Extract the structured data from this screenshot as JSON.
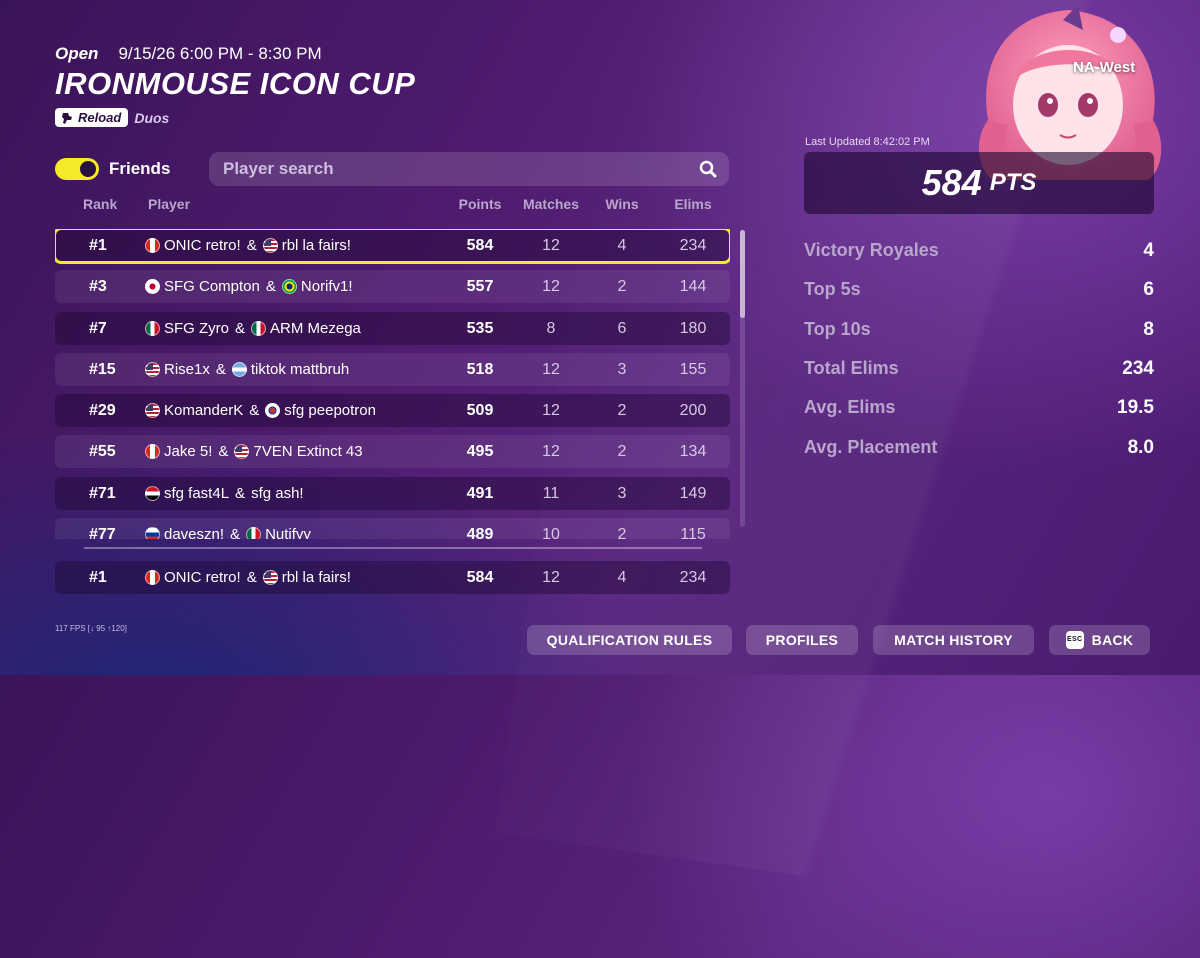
{
  "header": {
    "status": "Open",
    "datetime": "9/15/26 6:00 PM - 8:30 PM",
    "title": "IRONMOUSE ICON CUP",
    "mode_badge": "Reload",
    "team_size": "Duos"
  },
  "filters": {
    "friends_label": "Friends",
    "friends_on": true,
    "search_placeholder": "Player search"
  },
  "table": {
    "columns": [
      "Rank",
      "Player",
      "Points",
      "Matches",
      "Wins",
      "Elims"
    ],
    "rows": [
      {
        "rank": "#1",
        "p1": "ONIC retro!",
        "f1": "ca",
        "p2": "rbl la fairs!",
        "f2": "us",
        "points": "584",
        "matches": "12",
        "wins": "4",
        "elims": "234"
      },
      {
        "rank": "#3",
        "p1": "SFG Compton",
        "f1": "jp",
        "p2": "Norifv1!",
        "f2": "br",
        "points": "557",
        "matches": "12",
        "wins": "2",
        "elims": "144"
      },
      {
        "rank": "#7",
        "p1": "SFG Zyro",
        "f1": "mx",
        "p2": "ARM Mezega",
        "f2": "mx",
        "points": "535",
        "matches": "8",
        "wins": "6",
        "elims": "180"
      },
      {
        "rank": "#15",
        "p1": "Rise1x",
        "f1": "us",
        "p2": "tiktok mattbruh",
        "f2": "ar",
        "points": "518",
        "matches": "12",
        "wins": "3",
        "elims": "155"
      },
      {
        "rank": "#29",
        "p1": "KomanderK",
        "f1": "us",
        "p2": "sfg peepotron",
        "f2": "kr",
        "points": "509",
        "matches": "12",
        "wins": "2",
        "elims": "200"
      },
      {
        "rank": "#55",
        "p1": "Jake 5!",
        "f1": "ca",
        "p2": "7VEN Extinct 43",
        "f2": "us",
        "points": "495",
        "matches": "12",
        "wins": "2",
        "elims": "134"
      },
      {
        "rank": "#71",
        "p1": "sfg fast4L",
        "f1": "eg",
        "p2": "sfg ash!",
        "f2": "",
        "points": "491",
        "matches": "11",
        "wins": "3",
        "elims": "149"
      },
      {
        "rank": "#77",
        "p1": "daveszn!",
        "f1": "ru",
        "p2": "Nutifyy",
        "f2": "mx",
        "points": "489",
        "matches": "10",
        "wins": "2",
        "elims": "115"
      }
    ],
    "my_row": {
      "rank": "#1",
      "p1": "ONIC retro!",
      "f1": "ca",
      "p2": "rbl la fairs!",
      "f2": "us",
      "points": "584",
      "matches": "12",
      "wins": "4",
      "elims": "234"
    }
  },
  "panel": {
    "region": "NA-West",
    "last_updated": "Last Updated 8:42:02 PM",
    "points": "584",
    "points_unit": "PTS",
    "stats": [
      {
        "label": "Victory Royales",
        "value": "4"
      },
      {
        "label": "Top 5s",
        "value": "6"
      },
      {
        "label": "Top 10s",
        "value": "8"
      },
      {
        "label": "Total Elims",
        "value": "234"
      },
      {
        "label": "Avg. Elims",
        "value": "19.5"
      },
      {
        "label": "Avg. Placement",
        "value": "8.0"
      }
    ]
  },
  "footer": {
    "fps": "117 FPS [↓ 95 ↑120]",
    "qualification_label": "QUALIFICATION RULES",
    "profiles_label": "PROFILES",
    "match_history_label": "MATCH HISTORY",
    "esc_key": "ESC",
    "back_label": "BACK"
  },
  "colors": {
    "accent": "#f4ea2a",
    "background": "#4e1b6e"
  }
}
